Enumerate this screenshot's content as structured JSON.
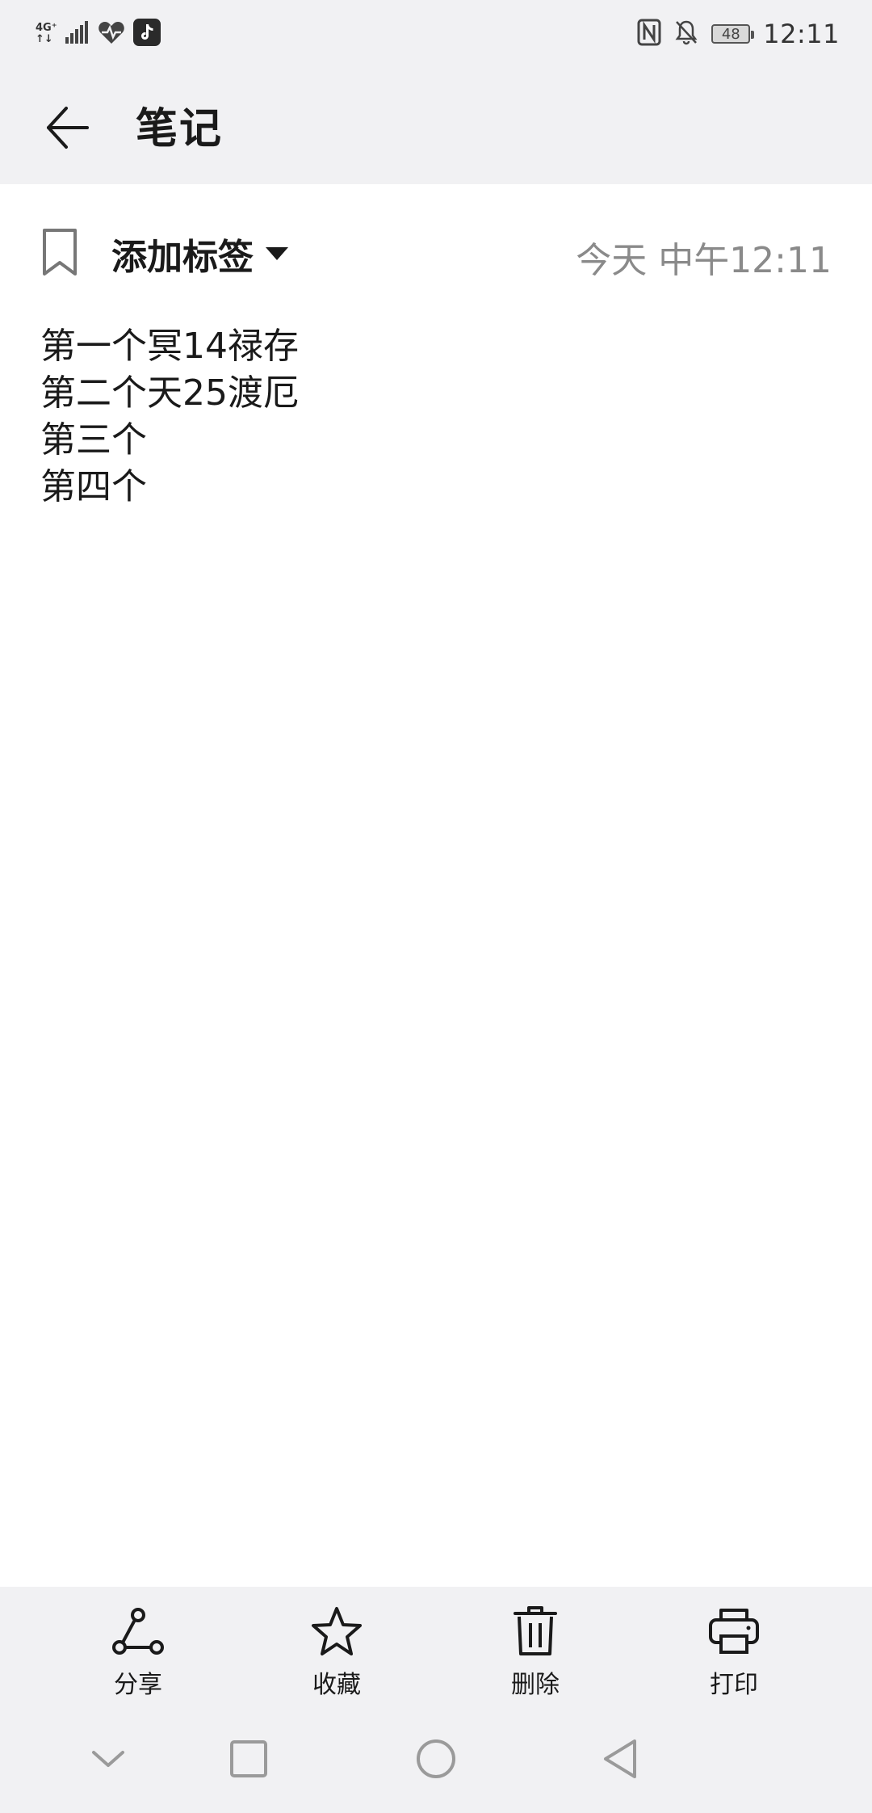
{
  "status_bar": {
    "network_type_top": "4G⁺",
    "network_type_bottom": "↑↓",
    "battery_level": "48",
    "time": "12:11"
  },
  "app_bar": {
    "title": "笔记"
  },
  "meta": {
    "tag_label": "添加标签",
    "date": "今天 中午12:11"
  },
  "note": {
    "lines": [
      "第一个冥14禄存",
      "第二个天25渡厄",
      "第三个",
      "第四个"
    ]
  },
  "toolbar": {
    "share_label": "分享",
    "favorite_label": "收藏",
    "delete_label": "删除",
    "print_label": "打印"
  },
  "icons": {
    "back": "arrow-left-icon",
    "tag": "bookmark-icon",
    "caret": "caret-down-icon",
    "share": "share-icon",
    "favorite": "star-icon",
    "delete": "trash-icon",
    "print": "printer-icon",
    "nav_down": "chevron-down-icon",
    "nav_recent": "square-icon",
    "nav_home": "circle-icon",
    "nav_back": "triangle-back-icon"
  },
  "colors": {
    "bar_background": "#f1f1f3",
    "text_primary": "#1a1a1a",
    "text_secondary": "#8a8a8a",
    "tiktok_icon": "#2a2a2a"
  }
}
